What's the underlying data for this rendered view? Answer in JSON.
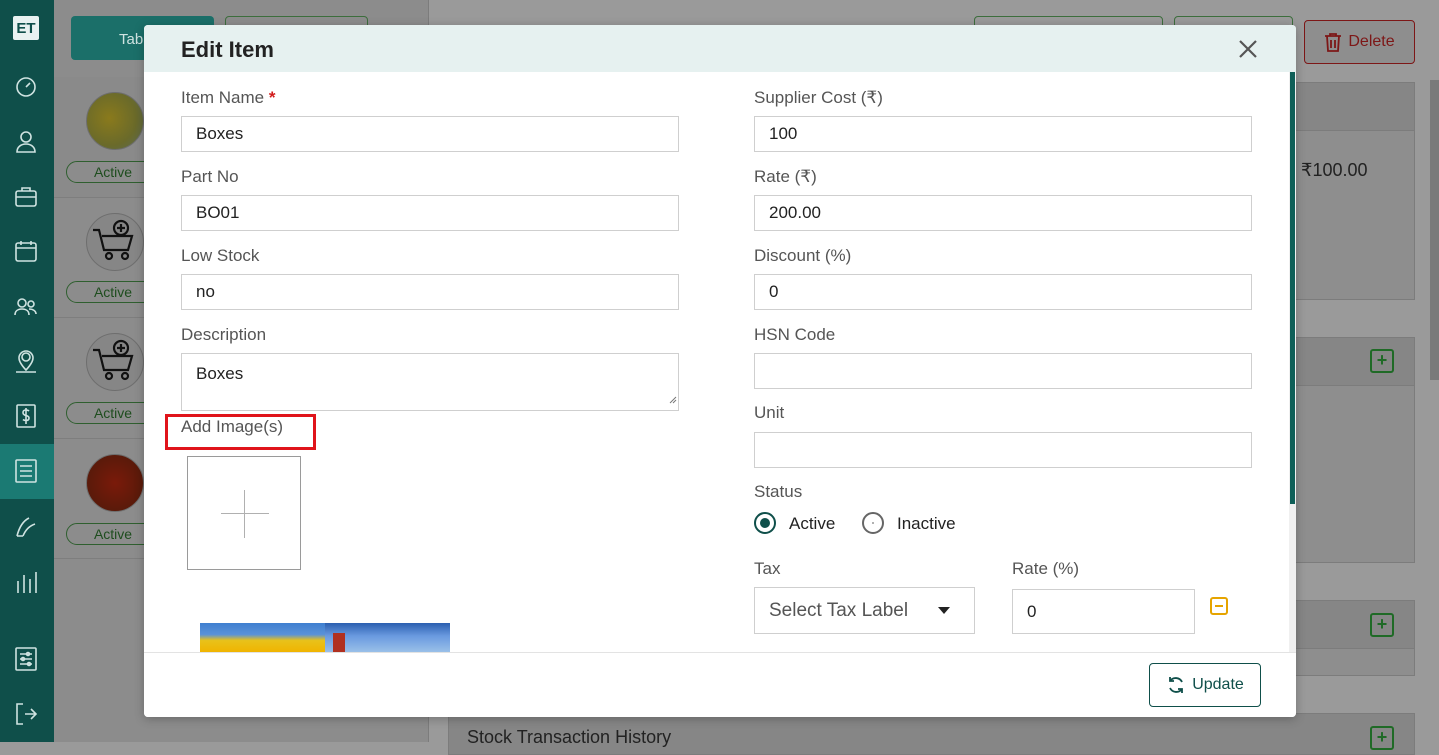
{
  "app": {
    "logo_text": "ET",
    "toolbar": {
      "table_btn_label": "Tab",
      "delete_label": "Delete"
    },
    "items": [
      {
        "status": "Active"
      },
      {
        "status": "Active"
      },
      {
        "status": "Active"
      },
      {
        "status": "Active"
      }
    ],
    "detail_price": "₹100.00",
    "stock_history_title": "Stock Transaction History"
  },
  "modal": {
    "title": "Edit Item",
    "fields": {
      "item_name": {
        "label": "Item Name",
        "required_mark": "*",
        "value": "Boxes"
      },
      "part_no": {
        "label": "Part No",
        "value": "BO01"
      },
      "low_stock": {
        "label": "Low Stock",
        "value": "no"
      },
      "description": {
        "label": "Description",
        "value": "Boxes"
      },
      "supplier_cost": {
        "label": "Supplier Cost (₹)",
        "value": "100"
      },
      "rate": {
        "label": "Rate (₹)",
        "value": "200.00"
      },
      "discount": {
        "label": "Discount (%)",
        "value": "0"
      },
      "hsn_code": {
        "label": "HSN Code",
        "value": ""
      },
      "unit": {
        "label": "Unit",
        "value": ""
      }
    },
    "add_images_label": "Add Image(s)",
    "status": {
      "label": "Status",
      "options": [
        "Active",
        "Inactive"
      ],
      "selected": "Active"
    },
    "tax": {
      "label": "Tax",
      "placeholder": "Select Tax Label",
      "rate_label": "Rate (%)",
      "rate_value": "0"
    },
    "update_label": "Update"
  },
  "colors": {
    "primary": "#0f4f4a",
    "highlight": "#e0141b",
    "warn": "#e6a400",
    "header_bg": "#e6f1f0"
  }
}
